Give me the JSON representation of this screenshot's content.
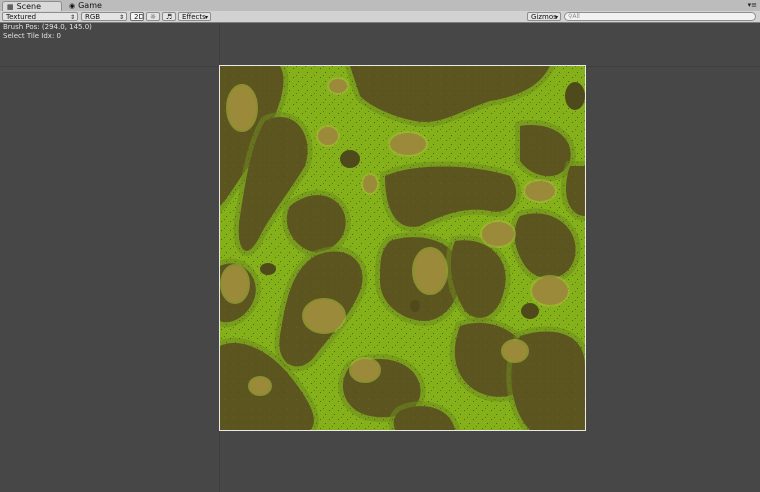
{
  "tabs": [
    {
      "label": "Scene",
      "icon": "scene-icon",
      "active": true
    },
    {
      "label": "Game",
      "icon": "game-icon",
      "active": false
    }
  ],
  "toolbar": {
    "shading_mode": "Textured",
    "render_mode": "RGB",
    "mode_2d": "2D",
    "effects": "Effects",
    "gizmos": "Gizmos",
    "search_placeholder": "All"
  },
  "overlay": {
    "brush_pos": "Brush Pos: (294.0, 145.0)",
    "select_tile": "Select Tile Idx: 0"
  },
  "colors": {
    "background": "#474747",
    "grass": "#84b11a",
    "dirt": "#5d5520",
    "sand": "#9a8a3a"
  }
}
